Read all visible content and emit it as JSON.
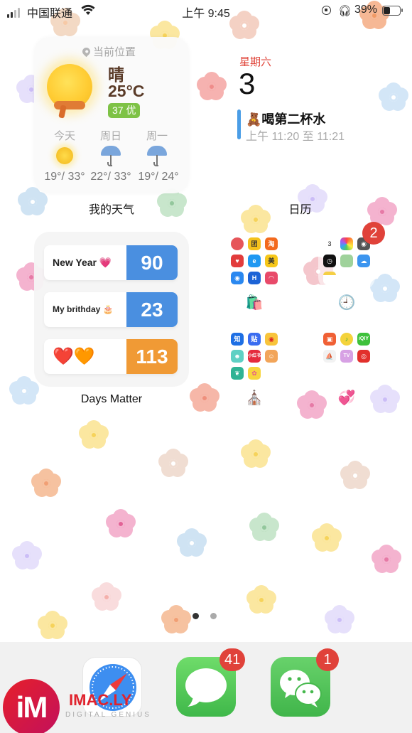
{
  "status_bar": {
    "carrier": "中国联通",
    "time": "上午 9:45",
    "battery_percent": "39%",
    "battery_level": 0.39,
    "icons": [
      "signal-icon",
      "wifi-icon",
      "rotation-lock-icon",
      "headphones-icon",
      "battery-icon"
    ]
  },
  "weather_widget": {
    "location": "当前位置",
    "condition": "晴",
    "temperature": "25°C",
    "aqi": "37 优",
    "forecast": [
      {
        "day": "今天",
        "icon": "sun-icon",
        "range": "19°/ 33°"
      },
      {
        "day": "周日",
        "icon": "umbrella-icon",
        "range": "22°/ 33°"
      },
      {
        "day": "周一",
        "icon": "umbrella-icon",
        "range": "19°/ 24°"
      }
    ],
    "label": "我的天气"
  },
  "calendar_widget": {
    "weekday": "星期六",
    "date": "3",
    "event_emoji": "🧸",
    "event_title": "喝第二杯水",
    "event_time": "上午 11:20 至 11:21",
    "label": "日历"
  },
  "days_matter_widget": {
    "items": [
      {
        "name": "New Year 💗",
        "days": "90",
        "color": "#4a8fe0"
      },
      {
        "name": "My brithday 🎂",
        "days": "23",
        "color": "#4a8fe0"
      },
      {
        "name": "❤️🧡",
        "days": "113",
        "color": "#f09a35"
      }
    ],
    "label": "Days Matter"
  },
  "folders": [
    {
      "label": "🛍️",
      "badge": null,
      "apps": [
        "pinduoduo",
        "tuangou",
        "taobao",
        "xianyu",
        "eleme",
        "meituan",
        "wifi-key",
        "alipay-like",
        "mall"
      ]
    },
    {
      "label": "🕘",
      "badge": "2",
      "apps": [
        "calendar",
        "photos",
        "camera",
        "clock",
        "maps",
        "weather",
        "notes"
      ]
    },
    {
      "label": "⛪",
      "badge": null,
      "apps": [
        "zhihu",
        "tieba",
        "weibo",
        "soul",
        "xiaohongshu",
        "game",
        "leaf",
        "flower"
      ]
    },
    {
      "label": "💞",
      "badge": null,
      "apps": [
        "kuaishou",
        "music",
        "iqiyi",
        "travel",
        "tv",
        "netease-music"
      ]
    }
  ],
  "page_indicator": {
    "current": 1,
    "total": 2
  },
  "dock": [
    {
      "name": "Safari",
      "icon": "safari-icon",
      "badge": null
    },
    {
      "name": "Messages",
      "icon": "messages-icon",
      "badge": "41"
    },
    {
      "name": "WeChat",
      "icon": "wechat-icon",
      "badge": "1"
    }
  ],
  "watermark": {
    "logo": "iM",
    "title": "IMAC.LY",
    "subtitle": "DIGITAL GENIUS"
  }
}
